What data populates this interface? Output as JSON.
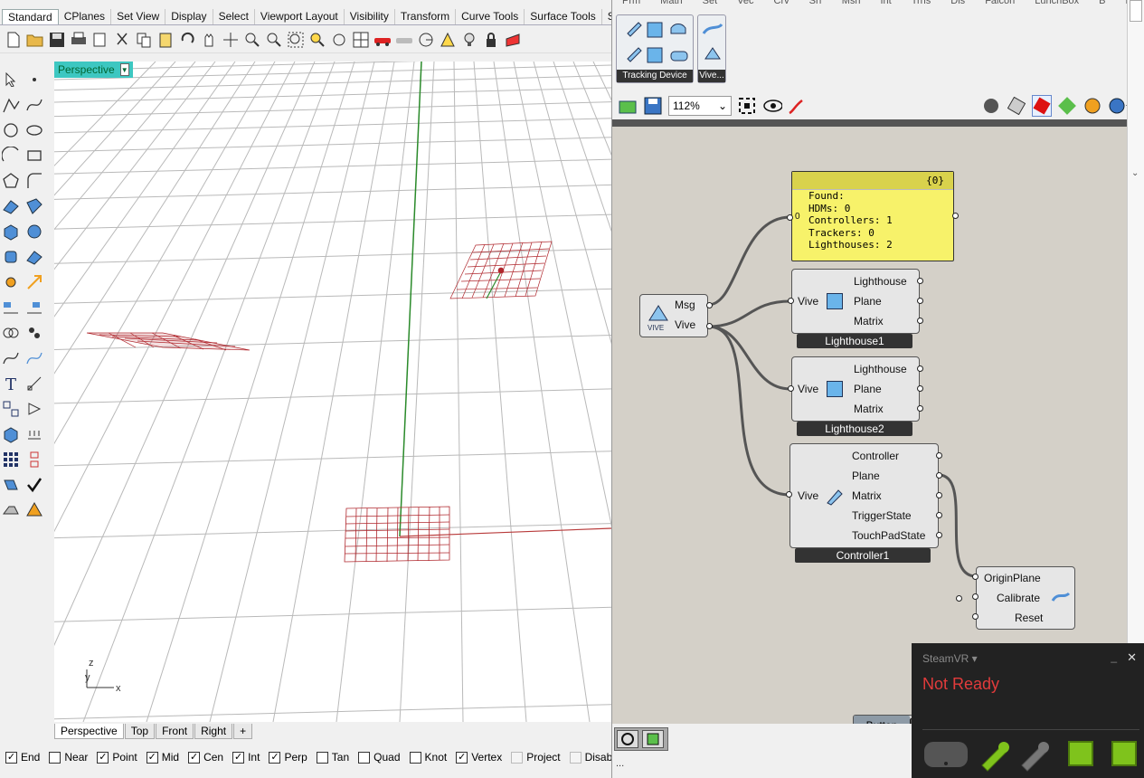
{
  "rhino": {
    "menu_tabs": [
      "Standard",
      "CPlanes",
      "Set View",
      "Display",
      "Select",
      "Viewport Layout",
      "Visibility",
      "Transform",
      "Curve Tools",
      "Surface Tools",
      "S"
    ],
    "viewport": {
      "label": "Perspective",
      "tabs": [
        "Perspective",
        "Top",
        "Front",
        "Right"
      ],
      "add_tab": "+",
      "axes": {
        "z": "z",
        "y": "y",
        "x": "x"
      }
    },
    "osnaps": [
      {
        "label": "End",
        "checked": true
      },
      {
        "label": "Near",
        "checked": false
      },
      {
        "label": "Point",
        "checked": true
      },
      {
        "label": "Mid",
        "checked": true
      },
      {
        "label": "Cen",
        "checked": true
      },
      {
        "label": "Int",
        "checked": true
      },
      {
        "label": "Perp",
        "checked": true
      },
      {
        "label": "Tan",
        "checked": false
      },
      {
        "label": "Quad",
        "checked": false
      },
      {
        "label": "Knot",
        "checked": false
      },
      {
        "label": "Vertex",
        "checked": true
      },
      {
        "label": "Project",
        "checked": false,
        "disabled": true
      },
      {
        "label": "Disable",
        "checked": false,
        "disabled": true
      }
    ]
  },
  "grasshopper": {
    "menu": [
      "Prm",
      "Math",
      "Set",
      "Vec",
      "Crv",
      "Srf",
      "Msh",
      "Int",
      "Trns",
      "Dis",
      "Falcon",
      "LunchBox",
      "B",
      "R"
    ],
    "ribbon_groups": [
      {
        "label": "Tracking Device"
      },
      {
        "label": "Vive..."
      }
    ],
    "zoom": "112%",
    "panel": {
      "header": "{0}",
      "index": "0",
      "lines": [
        "Found:",
        "HDMs: 0",
        "Controllers: 1",
        "Trackers: 0",
        "Lighthouses: 2"
      ]
    },
    "vive_comp": {
      "outputs": [
        "Msg",
        "Vive"
      ],
      "logo": "VIVE"
    },
    "lighthouse1": {
      "name": "Lighthouse1",
      "input": "Vive",
      "outputs": [
        "Lighthouse",
        "Plane",
        "Matrix"
      ]
    },
    "lighthouse2": {
      "name": "Lighthouse2",
      "input": "Vive",
      "outputs": [
        "Lighthouse",
        "Plane",
        "Matrix"
      ]
    },
    "controller1": {
      "name": "Controller1",
      "input": "Vive",
      "outputs": [
        "Controller",
        "Plane",
        "Matrix",
        "TriggerState",
        "TouchPadState"
      ]
    },
    "calibrate": {
      "inputs": [
        "OriginPlane",
        "Calibrate",
        "Reset"
      ]
    },
    "button": {
      "label": "Button"
    },
    "status": "..."
  },
  "steamvr": {
    "title": "SteamVR ▾",
    "status": "Not Ready",
    "minimize": "_",
    "close": "✕",
    "device_icons": [
      "hmd-icon",
      "controller-active-icon",
      "controller-inactive-icon",
      "basestation-icon",
      "basestation-icon"
    ],
    "colors": {
      "status": "#e23b3b",
      "active": "#7fc31c"
    }
  }
}
